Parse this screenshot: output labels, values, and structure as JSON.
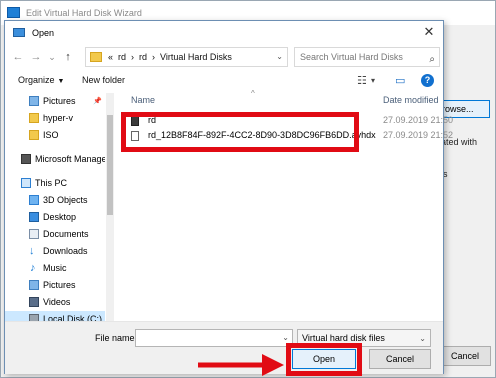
{
  "wizard": {
    "title": "Edit Virtual Hard Disk Wizard",
    "browse_label": "rowse...",
    "side_text_1": "ated with",
    "side_text_2": "is",
    "cancel_label": "Cancel"
  },
  "dialog": {
    "title": "Open",
    "close_glyph": "✕"
  },
  "nav": {
    "back_glyph": "←",
    "forward_glyph": "→",
    "recent_glyph": "⌄",
    "up_glyph": "↑",
    "address": "«  rd  ›  rd  ›  Virtual Hard Disks",
    "address_chevron": "⌄",
    "refresh_glyph": "↻",
    "search_placeholder": "Search Virtual Hard Disks",
    "search_glyph": "⌕"
  },
  "toolbar": {
    "organize": "Organize",
    "organize_caret": "▼",
    "new_folder": "New folder",
    "view_glyph": "☷",
    "view_caret": "▾",
    "preview_glyph": "▭",
    "help_glyph": "?"
  },
  "navpane": {
    "items": [
      {
        "label": "Pictures",
        "pin": "📌"
      },
      {
        "label": "hyper-v"
      },
      {
        "label": "ISO"
      },
      {
        "label": "Microsoft Manage"
      },
      {
        "label": "This PC"
      },
      {
        "label": "3D Objects"
      },
      {
        "label": "Desktop"
      },
      {
        "label": "Documents"
      },
      {
        "label": "Downloads"
      },
      {
        "label": "Music"
      },
      {
        "label": "Pictures"
      },
      {
        "label": "Videos"
      },
      {
        "label": "Local Disk (C:)"
      }
    ],
    "music_glyph": "♪",
    "download_glyph": "↓"
  },
  "filelist": {
    "col_name": "Name",
    "col_date": "Date modified",
    "sort_glyph": "^",
    "files": [
      {
        "name": "rd",
        "date": "27.09.2019 21:50"
      },
      {
        "name": "rd_12B8F84F-892F-4CC2-8D90-3D8DC96FB6DD.avhdx",
        "date": "27.09.2019 21:52"
      }
    ]
  },
  "bottom": {
    "filename_label": "File name:",
    "filename_value": "",
    "filename_caret": "⌄",
    "filetype_value": "Virtual hard disk files",
    "filetype_caret": "⌄",
    "open_label": "Open",
    "cancel_label": "Cancel"
  },
  "colors": {
    "highlight_red": "#e10b14",
    "accent_blue": "#0078d7"
  }
}
